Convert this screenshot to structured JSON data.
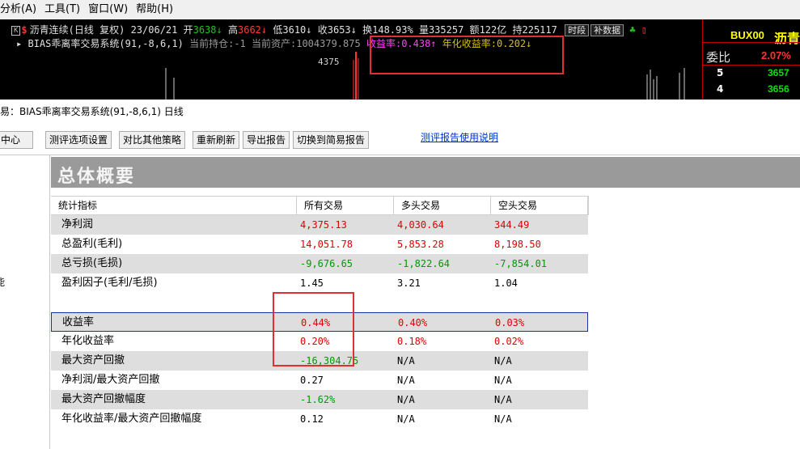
{
  "menubar": {
    "items": [
      "分析(A)",
      "工具(T)",
      "窗口(W)",
      "帮助(H)"
    ]
  },
  "quote": {
    "k_label": "K",
    "dollar": "$",
    "name": "沥青连续(日线 复权)",
    "date": "23/06/21",
    "open_label": "开",
    "open": "3638↓",
    "high_label": "高",
    "high": "3662↓",
    "low_label": "低",
    "low": "3610↓",
    "close_label": "收",
    "close": "3653↓",
    "turnover_label": "换",
    "turnover": "148.93%",
    "volume_label": "量",
    "volume": "335257",
    "amount_label": "额",
    "amount": "122亿",
    "holding_label": "持",
    "holding": "225117",
    "btn_timeseg": "时段",
    "btn_supplement": "补数据",
    "indicator": "BIAS乖离率交易系统(91,-8,6,1)",
    "position_label": "当前持仓:",
    "position": "-1",
    "assets_label": "当前资产:",
    "assets": "1004379.875",
    "return_label": "收益率:",
    "return_value": "0.438↑",
    "annual_label": "年化收益率:",
    "annual_value": "0.202↓",
    "price_level": "4375"
  },
  "right_panel": {
    "code": "BUX00",
    "name": "沥青",
    "ratio_label": "委比",
    "ratio": "2.07%",
    "rows": [
      {
        "index": "5",
        "price": "3657"
      },
      {
        "index": "4",
        "price": "3656"
      }
    ]
  },
  "report": {
    "title": "易：BIAS乖离率交易系统(91,-8,6,1) 日线",
    "left_tab": "中心",
    "toolbar": [
      "测评选项设置",
      "对比其他策略",
      "重新刷新",
      "导出报告",
      "切换到简易报告"
    ],
    "help_link": "测评报告使用说明",
    "left_glyph": "能",
    "overview_title": "总体概要",
    "columns": [
      "统计指标",
      "所有交易",
      "多头交易",
      "空头交易"
    ],
    "rows": [
      {
        "label": "净利润",
        "all": "4,375.13",
        "long": "4,030.64",
        "short": "344.49",
        "c_all": "pos",
        "c_long": "pos",
        "c_short": "pos"
      },
      {
        "label": "总盈利(毛利)",
        "all": "14,051.78",
        "long": "5,853.28",
        "short": "8,198.50",
        "c_all": "pos",
        "c_long": "pos",
        "c_short": "pos"
      },
      {
        "label": "总亏损(毛损)",
        "all": "-9,676.65",
        "long": "-1,822.64",
        "short": "-7,854.01",
        "c_all": "neg",
        "c_long": "neg",
        "c_short": "neg"
      },
      {
        "label": "盈利因子(毛利/毛损)",
        "all": "1.45",
        "long": "3.21",
        "short": "1.04",
        "c_all": "neu",
        "c_long": "neu",
        "c_short": "neu"
      },
      {
        "label": "",
        "all": "",
        "long": "",
        "short": "",
        "c_all": "neu",
        "c_long": "neu",
        "c_short": "neu"
      },
      {
        "label": "收益率",
        "all": "0.44%",
        "long": "0.40%",
        "short": "0.03%",
        "c_all": "pos",
        "c_long": "pos",
        "c_short": "pos"
      },
      {
        "label": "年化收益率",
        "all": "0.20%",
        "long": "0.18%",
        "short": "0.02%",
        "c_all": "pos",
        "c_long": "pos",
        "c_short": "pos"
      },
      {
        "label": "最大资产回撤",
        "all": "-16,304.75",
        "long": "N/A",
        "short": "N/A",
        "c_all": "neg",
        "c_long": "neu",
        "c_short": "neu"
      },
      {
        "label": "净利润/最大资产回撤",
        "all": "0.27",
        "long": "N/A",
        "short": "N/A",
        "c_all": "neu",
        "c_long": "neu",
        "c_short": "neu"
      },
      {
        "label": "最大资产回撤幅度",
        "all": "-1.62%",
        "long": "N/A",
        "short": "N/A",
        "c_all": "neg",
        "c_long": "neu",
        "c_short": "neu"
      },
      {
        "label": "年化收益率/最大资产回撤幅度",
        "all": "0.12",
        "long": "N/A",
        "short": "N/A",
        "c_all": "neu",
        "c_long": "neu",
        "c_short": "neu"
      }
    ]
  },
  "colors": {
    "positive": "#e00000",
    "negative": "#009900",
    "highlight": "#e03030",
    "selection": "#1b2fa5"
  }
}
